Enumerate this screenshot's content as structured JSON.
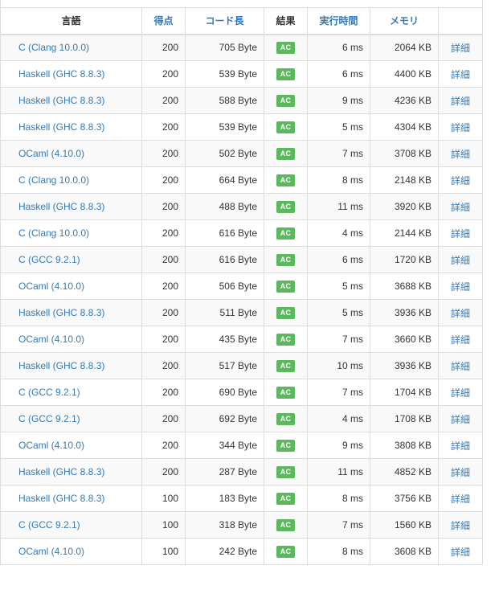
{
  "table": {
    "headers": {
      "language": "言語",
      "score": "得点",
      "code_length": "コード長",
      "result": "結果",
      "exec_time": "実行時間",
      "memory": "メモリ"
    },
    "detail_label": "詳細",
    "status_color": "#5cb85c",
    "link_color": "#337ab7",
    "rows": [
      {
        "language": "C (Clang 10.0.0)",
        "score": "200",
        "code_length": "705 Byte",
        "result": "AC",
        "exec_time": "6 ms",
        "memory": "2064 KB"
      },
      {
        "language": "Haskell (GHC 8.8.3)",
        "score": "200",
        "code_length": "539 Byte",
        "result": "AC",
        "exec_time": "6 ms",
        "memory": "4400 KB"
      },
      {
        "language": "Haskell (GHC 8.8.3)",
        "score": "200",
        "code_length": "588 Byte",
        "result": "AC",
        "exec_time": "9 ms",
        "memory": "4236 KB"
      },
      {
        "language": "Haskell (GHC 8.8.3)",
        "score": "200",
        "code_length": "539 Byte",
        "result": "AC",
        "exec_time": "5 ms",
        "memory": "4304 KB"
      },
      {
        "language": "OCaml (4.10.0)",
        "score": "200",
        "code_length": "502 Byte",
        "result": "AC",
        "exec_time": "7 ms",
        "memory": "3708 KB"
      },
      {
        "language": "C (Clang 10.0.0)",
        "score": "200",
        "code_length": "664 Byte",
        "result": "AC",
        "exec_time": "8 ms",
        "memory": "2148 KB"
      },
      {
        "language": "Haskell (GHC 8.8.3)",
        "score": "200",
        "code_length": "488 Byte",
        "result": "AC",
        "exec_time": "11 ms",
        "memory": "3920 KB"
      },
      {
        "language": "C (Clang 10.0.0)",
        "score": "200",
        "code_length": "616 Byte",
        "result": "AC",
        "exec_time": "4 ms",
        "memory": "2144 KB"
      },
      {
        "language": "C (GCC 9.2.1)",
        "score": "200",
        "code_length": "616 Byte",
        "result": "AC",
        "exec_time": "6 ms",
        "memory": "1720 KB"
      },
      {
        "language": "OCaml (4.10.0)",
        "score": "200",
        "code_length": "506 Byte",
        "result": "AC",
        "exec_time": "5 ms",
        "memory": "3688 KB"
      },
      {
        "language": "Haskell (GHC 8.8.3)",
        "score": "200",
        "code_length": "511 Byte",
        "result": "AC",
        "exec_time": "5 ms",
        "memory": "3936 KB"
      },
      {
        "language": "OCaml (4.10.0)",
        "score": "200",
        "code_length": "435 Byte",
        "result": "AC",
        "exec_time": "7 ms",
        "memory": "3660 KB"
      },
      {
        "language": "Haskell (GHC 8.8.3)",
        "score": "200",
        "code_length": "517 Byte",
        "result": "AC",
        "exec_time": "10 ms",
        "memory": "3936 KB"
      },
      {
        "language": "C (GCC 9.2.1)",
        "score": "200",
        "code_length": "690 Byte",
        "result": "AC",
        "exec_time": "7 ms",
        "memory": "1704 KB"
      },
      {
        "language": "C (GCC 9.2.1)",
        "score": "200",
        "code_length": "692 Byte",
        "result": "AC",
        "exec_time": "4 ms",
        "memory": "1708 KB"
      },
      {
        "language": "OCaml (4.10.0)",
        "score": "200",
        "code_length": "344 Byte",
        "result": "AC",
        "exec_time": "9 ms",
        "memory": "3808 KB"
      },
      {
        "language": "Haskell (GHC 8.8.3)",
        "score": "200",
        "code_length": "287 Byte",
        "result": "AC",
        "exec_time": "11 ms",
        "memory": "4852 KB"
      },
      {
        "language": "Haskell (GHC 8.8.3)",
        "score": "100",
        "code_length": "183 Byte",
        "result": "AC",
        "exec_time": "8 ms",
        "memory": "3756 KB"
      },
      {
        "language": "C (GCC 9.2.1)",
        "score": "100",
        "code_length": "318 Byte",
        "result": "AC",
        "exec_time": "7 ms",
        "memory": "1560 KB"
      },
      {
        "language": "OCaml (4.10.0)",
        "score": "100",
        "code_length": "242 Byte",
        "result": "AC",
        "exec_time": "8 ms",
        "memory": "3608 KB"
      }
    ]
  }
}
